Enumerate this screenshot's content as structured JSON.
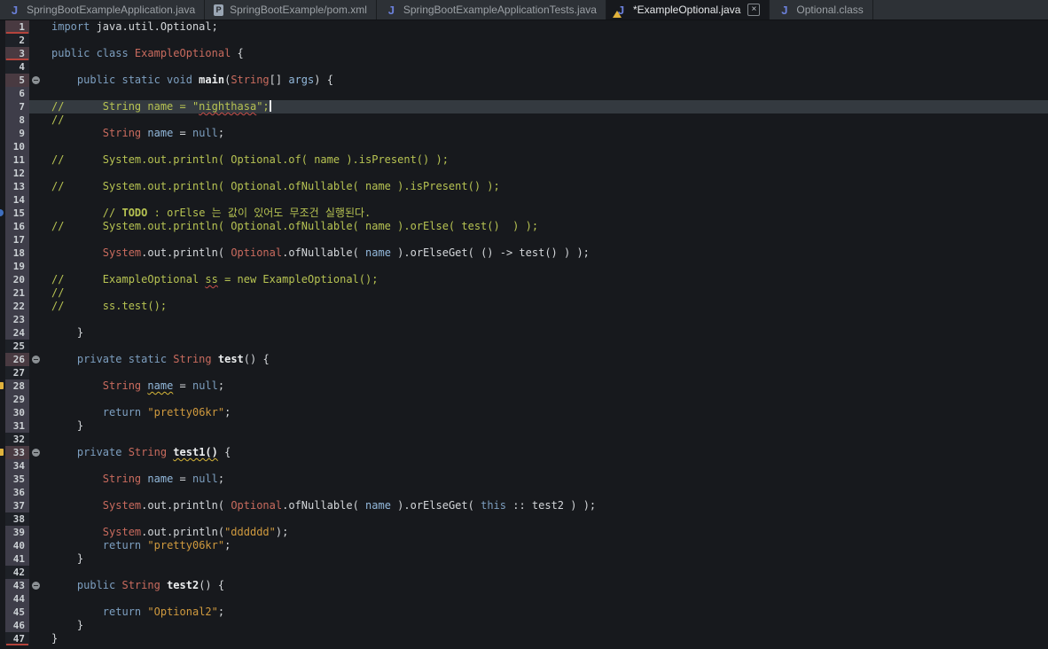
{
  "colors": {
    "edbg": "#17191d",
    "tabbg": "#2d3136",
    "tabactivebg": "#17191d",
    "tabtext": "#9ba0a5",
    "tabactivetext": "#e6e8ea",
    "kw": "#7d9fc0",
    "type": "#c96b5e",
    "str": "#d09a3e",
    "com": "#b7c352",
    "var": "#93b9dc",
    "plain": "#d4d7da",
    "meth": "#eceeef",
    "lnum": "#ccd1d5",
    "gd": "#1e2127",
    "gl": "#3e3d49",
    "gr": "#493a41",
    "curline": "#343a40",
    "rulerbg": "#17191d",
    "diffred": "#b5443c",
    "sqred": "#c94f4a",
    "sqyellow": "#d8b83a",
    "foldbg": "#8b9094",
    "taskblue": "#3f6fbf",
    "warnyellow": "#e0b23c",
    "jicon": "#6b80da",
    "pomiconbg": "#9aa6b4"
  },
  "tabs": [
    {
      "label": "SpringBootExampleApplication.java",
      "icon": "java",
      "active": false
    },
    {
      "label": "SpringBootExample/pom.xml",
      "icon": "pom",
      "icon_letter": "P",
      "active": false
    },
    {
      "label": "SpringBootExampleApplicationTests.java",
      "icon": "java",
      "active": false
    },
    {
      "label": "*ExampleOptional.java",
      "icon": "java-warning",
      "active": true,
      "close": "×",
      "dirty": true
    },
    {
      "label": "Optional.class",
      "icon": "java",
      "active": false
    }
  ],
  "editor": {
    "current_line": 7,
    "lines": [
      {
        "n": 1,
        "g": "r",
        "d": true,
        "segs": [
          [
            "k",
            "import"
          ],
          [
            "p",
            " java.util.Optional;"
          ]
        ]
      },
      {
        "n": 2,
        "g": "d",
        "segs": []
      },
      {
        "n": 3,
        "g": "r",
        "d": true,
        "segs": [
          [
            "k",
            "public class "
          ],
          [
            "t",
            "ExampleOptional"
          ],
          [
            "p",
            " {"
          ]
        ]
      },
      {
        "n": 4,
        "g": "d",
        "segs": []
      },
      {
        "n": 5,
        "g": "r",
        "f": true,
        "segs": [
          [
            "k",
            "    public static void "
          ],
          [
            "m",
            "main"
          ],
          [
            "p",
            "("
          ],
          [
            "t",
            "String"
          ],
          [
            "p",
            "[] "
          ],
          [
            "v",
            "args"
          ],
          [
            "p",
            ") {"
          ]
        ]
      },
      {
        "n": 6,
        "g": "l",
        "segs": []
      },
      {
        "n": 7,
        "g": "l",
        "cursor": true,
        "segs": [
          [
            "c",
            "//      String name = \""
          ],
          [
            "c sqr",
            "nighthasa"
          ],
          [
            "c",
            "\";"
          ]
        ]
      },
      {
        "n": 8,
        "g": "l",
        "segs": [
          [
            "c",
            "//"
          ]
        ]
      },
      {
        "n": 9,
        "g": "l",
        "segs": [
          [
            "t",
            "        String"
          ],
          [
            "p",
            " "
          ],
          [
            "v",
            "name"
          ],
          [
            "p",
            " = "
          ],
          [
            "k",
            "null"
          ],
          [
            "p",
            ";"
          ]
        ]
      },
      {
        "n": 10,
        "g": "l",
        "segs": []
      },
      {
        "n": 11,
        "g": "l",
        "segs": [
          [
            "c",
            "//      System.out.println( Optional.of( name ).isPresent() );"
          ]
        ]
      },
      {
        "n": 12,
        "g": "l",
        "segs": []
      },
      {
        "n": 13,
        "g": "l",
        "segs": [
          [
            "c",
            "//      System.out.println( Optional.ofNullable( name ).isPresent() );"
          ]
        ]
      },
      {
        "n": 14,
        "g": "l",
        "segs": []
      },
      {
        "n": 15,
        "g": "l",
        "mk": "task",
        "segs": [
          [
            "c",
            "        // "
          ],
          [
            "ctodo",
            "TODO"
          ],
          [
            "c",
            " : orElse 는 값이 있어도 무조건 실행된다."
          ]
        ]
      },
      {
        "n": 16,
        "g": "l",
        "segs": [
          [
            "c",
            "//      System.out.println( Optional.ofNullable( name ).orElse( test()  ) );"
          ]
        ]
      },
      {
        "n": 17,
        "g": "l",
        "segs": []
      },
      {
        "n": 18,
        "g": "l",
        "segs": [
          [
            "t",
            "        System"
          ],
          [
            "p",
            ".out.println( "
          ],
          [
            "t",
            "Optional"
          ],
          [
            "p",
            ".ofNullable( "
          ],
          [
            "v",
            "name"
          ],
          [
            "p",
            " ).orElseGet( () -> test() ) );"
          ]
        ]
      },
      {
        "n": 19,
        "g": "l",
        "segs": []
      },
      {
        "n": 20,
        "g": "l",
        "segs": [
          [
            "c",
            "//      ExampleOptional "
          ],
          [
            "c sqr",
            "ss"
          ],
          [
            "c",
            " = new ExampleOptional();"
          ]
        ]
      },
      {
        "n": 21,
        "g": "l",
        "segs": [
          [
            "c",
            "//"
          ]
        ]
      },
      {
        "n": 22,
        "g": "l",
        "segs": [
          [
            "c",
            "//      ss.test();"
          ]
        ]
      },
      {
        "n": 23,
        "g": "l",
        "segs": []
      },
      {
        "n": 24,
        "g": "l",
        "segs": [
          [
            "p",
            "    }"
          ]
        ]
      },
      {
        "n": 25,
        "g": "d",
        "segs": []
      },
      {
        "n": 26,
        "g": "r",
        "f": true,
        "segs": [
          [
            "k",
            "    private static "
          ],
          [
            "t",
            "String"
          ],
          [
            "p",
            " "
          ],
          [
            "m",
            "test"
          ],
          [
            "p",
            "() {"
          ]
        ]
      },
      {
        "n": 27,
        "g": "d",
        "segs": []
      },
      {
        "n": 28,
        "g": "l",
        "mk": "warn",
        "segs": [
          [
            "t",
            "        String"
          ],
          [
            "p",
            " "
          ],
          [
            "v sqy",
            "name"
          ],
          [
            "p",
            " = "
          ],
          [
            "k",
            "null"
          ],
          [
            "p",
            ";"
          ]
        ]
      },
      {
        "n": 29,
        "g": "l",
        "segs": []
      },
      {
        "n": 30,
        "g": "l",
        "segs": [
          [
            "k",
            "        return"
          ],
          [
            "p",
            " "
          ],
          [
            "s",
            "\"pretty06kr\""
          ],
          [
            "p",
            ";"
          ]
        ]
      },
      {
        "n": 31,
        "g": "l",
        "segs": [
          [
            "p",
            "    }"
          ]
        ]
      },
      {
        "n": 32,
        "g": "d",
        "segs": []
      },
      {
        "n": 33,
        "g": "r",
        "f": true,
        "mk": "warn",
        "segs": [
          [
            "k",
            "    private "
          ],
          [
            "t",
            "String"
          ],
          [
            "p",
            " "
          ],
          [
            "m sqy",
            "test1()"
          ],
          [
            "p",
            " {"
          ]
        ]
      },
      {
        "n": 34,
        "g": "l",
        "segs": []
      },
      {
        "n": 35,
        "g": "l",
        "segs": [
          [
            "t",
            "        String"
          ],
          [
            "p",
            " "
          ],
          [
            "v",
            "name"
          ],
          [
            "p",
            " = "
          ],
          [
            "k",
            "null"
          ],
          [
            "p",
            ";"
          ]
        ]
      },
      {
        "n": 36,
        "g": "l",
        "segs": []
      },
      {
        "n": 37,
        "g": "l",
        "segs": [
          [
            "t",
            "        System"
          ],
          [
            "p",
            ".out.println( "
          ],
          [
            "t",
            "Optional"
          ],
          [
            "p",
            ".ofNullable( "
          ],
          [
            "v",
            "name"
          ],
          [
            "p",
            " ).orElseGet( "
          ],
          [
            "k",
            "this"
          ],
          [
            "p",
            " :: test2 ) );"
          ]
        ]
      },
      {
        "n": 38,
        "g": "d",
        "segs": []
      },
      {
        "n": 39,
        "g": "l",
        "segs": [
          [
            "t",
            "        System"
          ],
          [
            "p",
            ".out.println("
          ],
          [
            "s",
            "\"dddddd\""
          ],
          [
            "p",
            ");"
          ]
        ]
      },
      {
        "n": 40,
        "g": "l",
        "segs": [
          [
            "k",
            "        return"
          ],
          [
            "p",
            " "
          ],
          [
            "s",
            "\"pretty06kr\""
          ],
          [
            "p",
            ";"
          ]
        ]
      },
      {
        "n": 41,
        "g": "l",
        "segs": [
          [
            "p",
            "    }"
          ]
        ]
      },
      {
        "n": 42,
        "g": "d",
        "segs": []
      },
      {
        "n": 43,
        "g": "l",
        "f": true,
        "segs": [
          [
            "k",
            "    public "
          ],
          [
            "t",
            "String"
          ],
          [
            "p",
            " "
          ],
          [
            "m",
            "test2"
          ],
          [
            "p",
            "() {"
          ]
        ]
      },
      {
        "n": 44,
        "g": "l",
        "segs": []
      },
      {
        "n": 45,
        "g": "l",
        "segs": [
          [
            "k",
            "        return"
          ],
          [
            "p",
            " "
          ],
          [
            "s",
            "\"Optional2\""
          ],
          [
            "p",
            ";"
          ]
        ]
      },
      {
        "n": 46,
        "g": "l",
        "segs": [
          [
            "p",
            "    }"
          ]
        ]
      },
      {
        "n": 47,
        "g": "d",
        "d": true,
        "segs": [
          [
            "p",
            "}"
          ]
        ]
      }
    ]
  }
}
